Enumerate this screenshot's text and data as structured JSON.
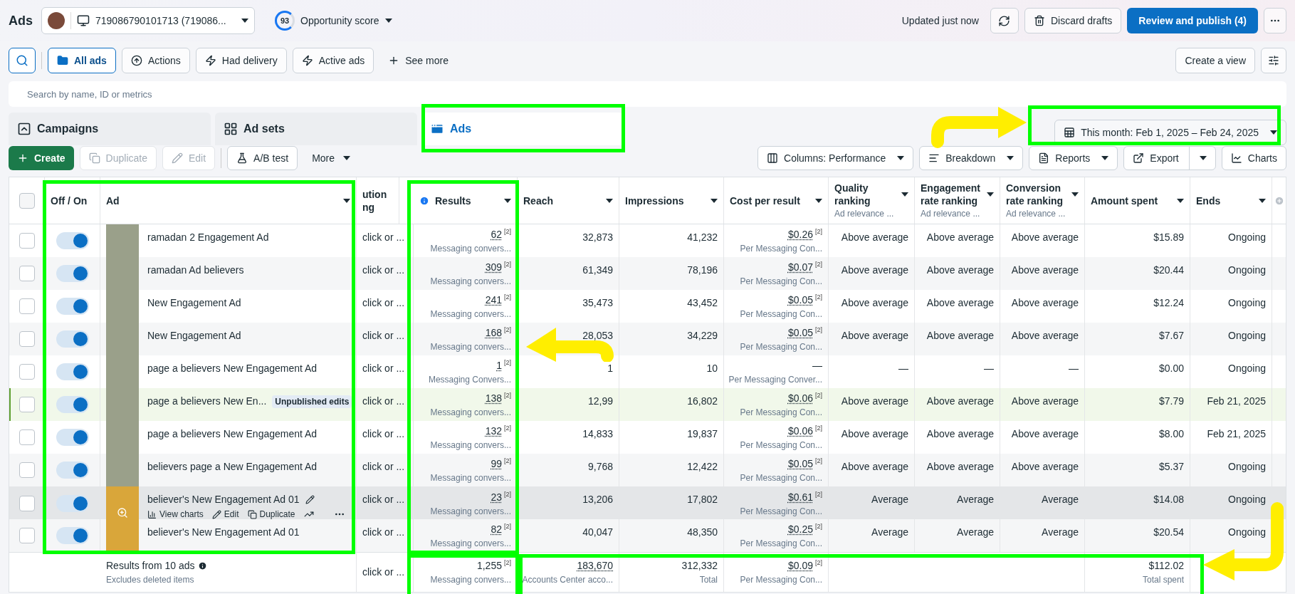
{
  "header": {
    "title": "Ads",
    "account": "719086790101713 (719086...",
    "score": "93",
    "score_label": "Opportunity score",
    "updated": "Updated just now",
    "discard": "Discard drafts",
    "publish": "Review and publish (4)"
  },
  "filters": {
    "items": [
      {
        "kind": "folder",
        "label": "All ads",
        "selected": true
      },
      {
        "kind": "actions",
        "label": "Actions",
        "selected": false
      },
      {
        "kind": "bolt",
        "label": "Had delivery",
        "selected": false
      },
      {
        "kind": "bolt",
        "label": "Active ads",
        "selected": false
      }
    ],
    "see_more": "See more",
    "create_view": "Create a view",
    "search": {
      "placeholder": "Search by name, ID or metrics"
    }
  },
  "tabs": [
    {
      "kind": "campaigns",
      "label": "Campaigns",
      "selected": false
    },
    {
      "kind": "adsets",
      "label": "Ad sets",
      "selected": false
    },
    {
      "kind": "ads",
      "label": "Ads",
      "selected": true
    }
  ],
  "date_range": "This month: Feb 1, 2025 – Feb 24, 2025",
  "toolbar": {
    "left": [
      {
        "kind": "create",
        "label": "Create",
        "disabled": false
      },
      {
        "kind": "duplicate",
        "label": "Duplicate",
        "disabled": true
      },
      {
        "kind": "edit",
        "label": "Edit",
        "disabled": true
      },
      {
        "kind": "abtest",
        "label": "A/B test",
        "disabled": false
      },
      {
        "kind": "more",
        "label": "More",
        "disabled": false
      }
    ],
    "right": [
      {
        "kind": "columns",
        "label": "Columns: Performance"
      },
      {
        "kind": "breakdown",
        "label": "Breakdown"
      },
      {
        "kind": "reports",
        "label": "Reports"
      },
      {
        "kind": "export",
        "label": "Export"
      },
      {
        "kind": "charts",
        "label": "Charts"
      }
    ]
  },
  "table": {
    "all_selected": false,
    "columns": [
      {
        "label": "Off / On",
        "caret": false,
        "info": false
      },
      {
        "label": "Ad",
        "caret": true,
        "info": false
      },
      {
        "label": "ution ng",
        "caret": false,
        "info": false
      },
      {
        "label": "Results",
        "caret": true,
        "info": true
      },
      {
        "label": "Reach",
        "caret": true,
        "info": false
      },
      {
        "label": "Impressions",
        "caret": true,
        "info": false
      },
      {
        "label": "Cost per result",
        "caret": true,
        "info": false
      },
      {
        "label": "Quality ranking",
        "sub": "Ad relevance ...",
        "caret": true,
        "info": false
      },
      {
        "label": "Engagement rate ranking",
        "sub": "Ad relevance ...",
        "caret": true,
        "info": false
      },
      {
        "label": "Conversion rate ranking",
        "sub": "Ad relevance ...",
        "caret": true,
        "info": false
      },
      {
        "label": "Amount spent",
        "caret": true,
        "info": false
      },
      {
        "label": "Ends",
        "caret": true,
        "info": false
      }
    ],
    "rows": [
      {
        "selected": false,
        "on": true,
        "hovered": false,
        "edited": false,
        "name": "ramadan 2 Engagement Ad",
        "attribution": "click or ...",
        "results": "62",
        "results_note": "[2]",
        "results_sub": "Messaging convers...",
        "reach": "32,873",
        "impressions": "41,232",
        "cost": "$0.26",
        "cost_note": "[2]",
        "cost_sub": "Per Messaging Con...",
        "quality": "Above average",
        "engagement": "Above average",
        "conversion": "Above average",
        "spent": "$15.89",
        "ends": "Ongoing"
      },
      {
        "selected": false,
        "on": true,
        "hovered": false,
        "edited": false,
        "name": "ramadan Ad believers",
        "attribution": "click or ...",
        "results": "309",
        "results_note": "[2]",
        "results_sub": "Messaging convers...",
        "reach": "61,349",
        "impressions": "78,196",
        "cost": "$0.07",
        "cost_note": "[2]",
        "cost_sub": "Per Messaging Con...",
        "quality": "Above average",
        "engagement": "Above average",
        "conversion": "Above average",
        "spent": "$20.44",
        "ends": "Ongoing"
      },
      {
        "selected": false,
        "on": true,
        "hovered": false,
        "edited": false,
        "name": "New Engagement Ad",
        "attribution": "click or ...",
        "results": "241",
        "results_note": "[2]",
        "results_sub": "Messaging convers...",
        "reach": "35,473",
        "impressions": "43,452",
        "cost": "$0.05",
        "cost_note": "[2]",
        "cost_sub": "Per Messaging Con...",
        "quality": "Above average",
        "engagement": "Above average",
        "conversion": "Above average",
        "spent": "$12.24",
        "ends": "Ongoing"
      },
      {
        "selected": false,
        "on": true,
        "hovered": false,
        "edited": false,
        "name": "New Engagement Ad",
        "attribution": "click or ...",
        "results": "168",
        "results_note": "[2]",
        "results_sub": "Messaging convers...",
        "reach": "28,053",
        "impressions": "34,229",
        "cost": "$0.05",
        "cost_note": "[2]",
        "cost_sub": "Per Messaging Con...",
        "quality": "Above average",
        "engagement": "Above average",
        "conversion": "Above average",
        "spent": "$7.67",
        "ends": "Ongoing"
      },
      {
        "selected": false,
        "on": true,
        "hovered": false,
        "edited": false,
        "name": "page a believers New Engagement Ad",
        "attribution": "click or ...",
        "results": "1",
        "results_note": "[2]",
        "results_sub": "Messaging Convers...",
        "reach": "1",
        "impressions": "10",
        "cost": "—",
        "cost_sub": "Per Messaging Conver...",
        "quality": "—",
        "engagement": "—",
        "conversion": "—",
        "spent": "$0.00",
        "ends": "Ongoing"
      },
      {
        "selected": false,
        "on": true,
        "hovered": false,
        "edited": true,
        "name": "page a believers New En...",
        "badge": "Unpublished edits",
        "attribution": "click or ...",
        "results": "138",
        "results_note": "[2]",
        "results_sub": "Messaging convers...",
        "reach": "12,99",
        "impressions": "16,802",
        "cost": "$0.06",
        "cost_note": "[2]",
        "cost_sub": "Per Messaging Con...",
        "quality": "Above average",
        "engagement": "Above average",
        "conversion": "Above average",
        "spent": "$7.79",
        "ends": "Feb 21, 2025"
      },
      {
        "selected": false,
        "on": true,
        "hovered": false,
        "edited": false,
        "name": "page a believers New Engagement Ad",
        "attribution": "click or ...",
        "results": "132",
        "results_note": "[2]",
        "results_sub": "Messaging convers...",
        "reach": "14,833",
        "impressions": "19,837",
        "cost": "$0.06",
        "cost_note": "[2]",
        "cost_sub": "Per Messaging Con...",
        "quality": "Above average",
        "engagement": "Above average",
        "conversion": "Above average",
        "spent": "$8.00",
        "ends": "Feb 21, 2025"
      },
      {
        "selected": false,
        "on": true,
        "hovered": false,
        "edited": false,
        "name": "believers page a New Engagement Ad",
        "attribution": "click or ...",
        "results": "99",
        "results_note": "[2]",
        "results_sub": "Messaging convers...",
        "reach": "9,768",
        "impressions": "12,422",
        "cost": "$0.05",
        "cost_note": "[2]",
        "cost_sub": "Per Messaging Con...",
        "quality": "Above average",
        "engagement": "Above average",
        "conversion": "Above average",
        "spent": "$5.37",
        "ends": "Ongoing"
      },
      {
        "selected": false,
        "on": true,
        "hovered": true,
        "edited": false,
        "name": "believer's New Engagement Ad 01",
        "actions": [
          {
            "kind": "charts",
            "label": "View charts"
          },
          {
            "kind": "edit",
            "label": "Edit"
          },
          {
            "kind": "duplicate",
            "label": "Duplicate"
          }
        ],
        "attribution": "click or ...",
        "results": "23",
        "results_note": "[2]",
        "results_sub": "Messaging convers...",
        "reach": "13,206",
        "impressions": "17,802",
        "cost": "$0.61",
        "cost_note": "[2]",
        "cost_sub": "Per Messaging Con...",
        "quality": "Average",
        "engagement": "Average",
        "conversion": "Average",
        "spent": "$14.08",
        "ends": "Ongoing"
      },
      {
        "selected": false,
        "on": true,
        "hovered": false,
        "edited": false,
        "name": "believer's New Engagement Ad 01",
        "attribution": "click or ...",
        "results": "82",
        "results_note": "[2]",
        "results_sub": "Messaging convers...",
        "reach": "40,047",
        "impressions": "48,350",
        "cost": "$0.25",
        "cost_note": "[2]",
        "cost_sub": "Per Messaging Con...",
        "quality": "Average",
        "engagement": "Average",
        "conversion": "Average",
        "spent": "$20.54",
        "ends": "Ongoing"
      }
    ],
    "footer": {
      "label": "Results from 10 ads",
      "sublabel": "Excludes deleted items",
      "attribution": "click or ...",
      "results": "1,255",
      "results_note": "[2]",
      "results_sub": "Messaging convers...",
      "reach": "183,670",
      "reach_sub": "Accounts Center acco...",
      "impressions": "312,332",
      "impressions_sub": "Total",
      "cost": "$0.09",
      "cost_note": "[2]",
      "cost_sub": "Per Messaging Con...",
      "spent": "$112.02",
      "spent_sub": "Total spent"
    }
  }
}
